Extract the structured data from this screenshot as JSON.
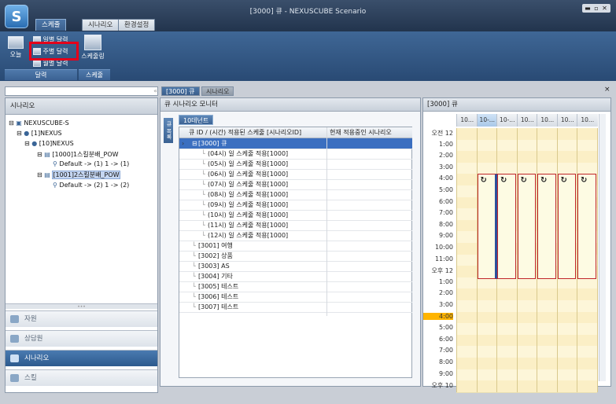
{
  "app": {
    "title": "[3000] 큐 - NEXUSCUBE Scenario",
    "logo": "S"
  },
  "ribbon": {
    "tabs": [
      "스케줄",
      "시나리오",
      "환경설정"
    ],
    "active_tab": 0,
    "buttons": {
      "today": "오늘",
      "daily": "일별 달력",
      "weekly": "주별 달력",
      "monthly": "월별 달력",
      "schedule_mgmt": "스케줄링"
    },
    "groups": {
      "calendar": "달력",
      "schedule": "스케줄"
    }
  },
  "left": {
    "header": "시나리오",
    "tree": [
      "NEXUSCUBE-S",
      "[1]NEXUS",
      "[10]NEXUS",
      "[1000]1스킬분배_POW",
      "Default -> (1)  1 -> (1)",
      "[1001]2스킬분배_POW",
      "Default -> (2)  1 -> (2)"
    ],
    "nav": [
      "자원",
      "상담원",
      "시나리오",
      "스킬"
    ],
    "nav_active": 2
  },
  "doc_tabs": [
    "[3000] 큐",
    "시나리오"
  ],
  "monitor": {
    "title": "큐 시나리오 모니터",
    "side_tab": "큐 목록",
    "sub_tab": "10데넌트",
    "columns": [
      "큐 ID / (시간) 적용된 스케줄 [시나리오ID]",
      "현재 적용중인 시나리오"
    ],
    "rows": [
      "[3000] 큐",
      "(04시) 일 스케줄 적용[1000]",
      "(05시) 일 스케줄 적용[1000]",
      "(06시) 일 스케줄 적용[1000]",
      "(07시) 일 스케줄 적용[1000]",
      "(08시) 일 스케줄 적용[1000]",
      "(09시) 일 스케줄 적용[1000]",
      "(10시) 일 스케줄 적용[1000]",
      "(11시) 일 스케줄 적용[1000]",
      "(12시) 일 스케줄 적용[1000]",
      "[3001] 여행",
      "[3002] 상품",
      "[3003] AS",
      "[3004] 기타",
      "[3005] 테스트",
      "[3006] 테스트",
      "[3007] 테스트"
    ]
  },
  "calendar": {
    "title": "[3000] 큐",
    "day_cols": [
      "10...",
      "10-...",
      "10-...",
      "10...",
      "10...",
      "10...",
      "10..."
    ],
    "times": [
      "오전 12",
      "1:00",
      "2:00",
      "3:00",
      "4:00",
      "5:00",
      "6:00",
      "7:00",
      "8:00",
      "9:00",
      "10:00",
      "11:00",
      "오후 12",
      "1:00",
      "2:00",
      "3:00",
      "4:00",
      "5:00",
      "6:00",
      "7:00",
      "8:00",
      "9:00",
      "오후 10"
    ],
    "block_icon": "↻",
    "colors": {
      "accent": "#3a6597",
      "block_border": "#c0252a",
      "highlight": "#ffb400"
    }
  }
}
